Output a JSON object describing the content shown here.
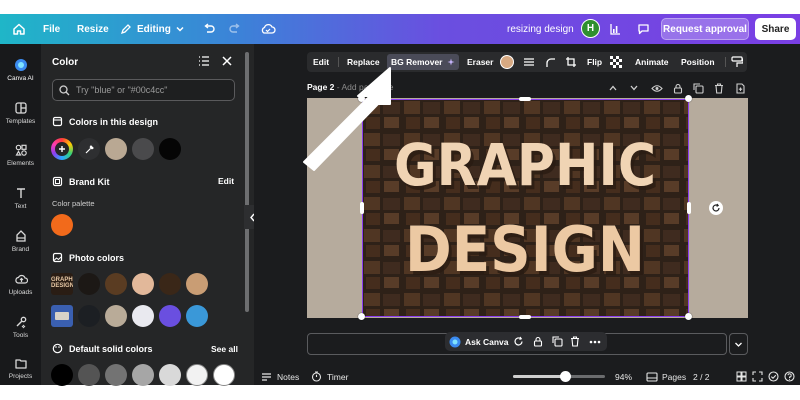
{
  "app": {
    "file_label": "File",
    "resize_label": "Resize",
    "editing_label": "Editing",
    "doc_title": "resizing design",
    "user_initial": "H",
    "request_approval_label": "Request approval",
    "share_label": "Share"
  },
  "rail": {
    "items": [
      {
        "label": "Canva AI",
        "icon": "canva-ai-icon"
      },
      {
        "label": "Templates",
        "icon": "templates-icon"
      },
      {
        "label": "Elements",
        "icon": "elements-icon"
      },
      {
        "label": "Text",
        "icon": "text-icon"
      },
      {
        "label": "Brand",
        "icon": "brand-icon"
      },
      {
        "label": "Uploads",
        "icon": "uploads-icon"
      },
      {
        "label": "Tools",
        "icon": "tools-icon"
      },
      {
        "label": "Projects",
        "icon": "projects-icon"
      }
    ]
  },
  "panel": {
    "title": "Color",
    "search_placeholder": "Try \"blue\" or \"#00c4cc\"",
    "colors_in_design": {
      "heading": "Colors in this design",
      "swatches": [
        "#b9a893",
        "#4a4a4c",
        "#050505"
      ]
    },
    "brand_kit": {
      "heading": "Brand Kit",
      "edit_label": "Edit",
      "palette_label": "Color palette",
      "swatches": [
        "#f26a1b"
      ]
    },
    "photo_colors": {
      "heading": "Photo colors",
      "row1": [
        "#1c1815",
        "#5a3c22",
        "#e2b89a",
        "#3a2718",
        "#c99d74"
      ],
      "row2": [
        "#1c1f23",
        "#b9ab98",
        "#e9e9ef",
        "#6a4fe0",
        "#3a98d8"
      ]
    },
    "default_solid": {
      "heading": "Default solid colors",
      "see_all_label": "See all",
      "swatches": [
        "#000000",
        "#545454",
        "#737373",
        "#a6a6a6",
        "#d9d9d9",
        "#f2f2f2",
        "#ffffff"
      ]
    }
  },
  "toolbar": {
    "edit": "Edit",
    "replace": "Replace",
    "bg_remover": "BG Remover",
    "eraser": "Eraser",
    "flip": "Flip",
    "animate": "Animate",
    "position": "Position",
    "fill_color": "#d7a982"
  },
  "page": {
    "label": "Page 2",
    "add_title": "Add page title"
  },
  "design": {
    "line1": "GRAPHIC",
    "line2": "DESIGN"
  },
  "ask": {
    "label": "Ask Canva"
  },
  "status": {
    "notes": "Notes",
    "timer": "Timer",
    "zoom": "94%",
    "zoom_fraction": 0.57,
    "pages": "Pages",
    "page_count": "2 / 2"
  }
}
